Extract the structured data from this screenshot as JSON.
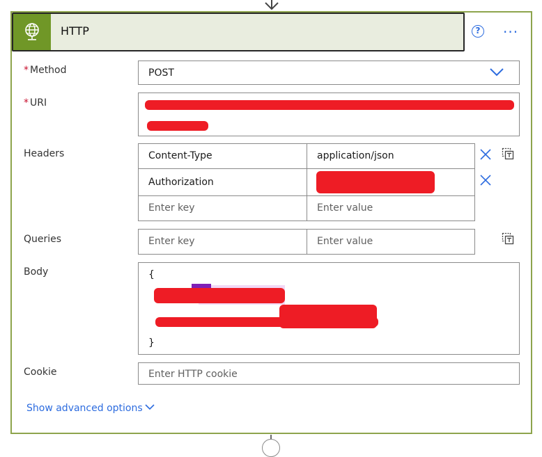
{
  "action": {
    "title": "HTTP",
    "icon": "globe-icon"
  },
  "toolbar": {
    "help_glyph": "?",
    "more_glyph": "···"
  },
  "fields": {
    "method": {
      "label": "Method",
      "required_mark": "*",
      "value": "POST"
    },
    "uri": {
      "label": "URI",
      "required_mark": "*",
      "value": ""
    },
    "headers": {
      "label": "Headers",
      "rows": [
        {
          "key": "Content-Type",
          "value": "application/json"
        },
        {
          "key": "Authorization",
          "value": ""
        }
      ],
      "key_placeholder": "Enter key",
      "value_placeholder": "Enter value"
    },
    "queries": {
      "label": "Queries",
      "key_placeholder": "Enter key",
      "value_placeholder": "Enter value"
    },
    "body": {
      "label": "Body",
      "open": "{",
      "close": "}"
    },
    "cookie": {
      "label": "Cookie",
      "placeholder": "Enter HTTP cookie"
    }
  },
  "advanced": {
    "label": "Show advanced options"
  },
  "colors": {
    "accent": "#2d6cdf",
    "brand": "#709727",
    "header_bg": "#e9eddf",
    "redaction": "#ee1c25"
  }
}
